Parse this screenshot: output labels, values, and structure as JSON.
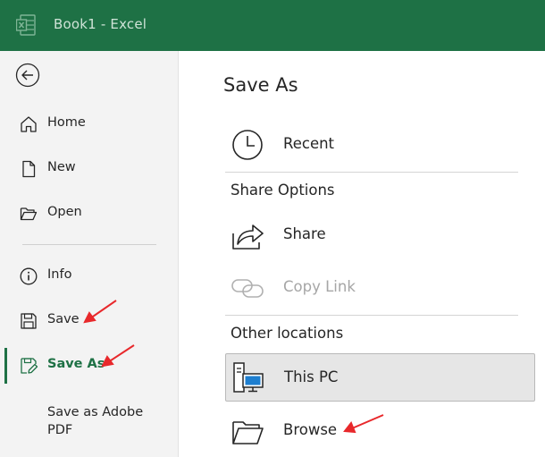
{
  "window": {
    "title": "Book1  -  Excel"
  },
  "colors": {
    "brand": "#1e7145",
    "accent_arrow": "#e8282b",
    "selected_bg": "#e6e6e6"
  },
  "sidebar": {
    "back_icon": "back-arrow-icon",
    "items": [
      {
        "label": "Home",
        "icon": "home-icon"
      },
      {
        "label": "New",
        "icon": "new-document-icon"
      },
      {
        "label": "Open",
        "icon": "open-folder-icon"
      },
      {
        "label": "Info",
        "icon": "info-icon"
      },
      {
        "label": "Save",
        "icon": "save-floppy-icon"
      },
      {
        "label": "Save As",
        "icon": "save-as-icon",
        "active": true
      },
      {
        "label": "Save as Adobe PDF"
      }
    ]
  },
  "main": {
    "title": "Save As",
    "recent_label": "Recent",
    "share_options_header": "Share Options",
    "share_label": "Share",
    "copy_link_label": "Copy Link",
    "other_locations_header": "Other locations",
    "this_pc_label": "This PC",
    "browse_label": "Browse"
  }
}
